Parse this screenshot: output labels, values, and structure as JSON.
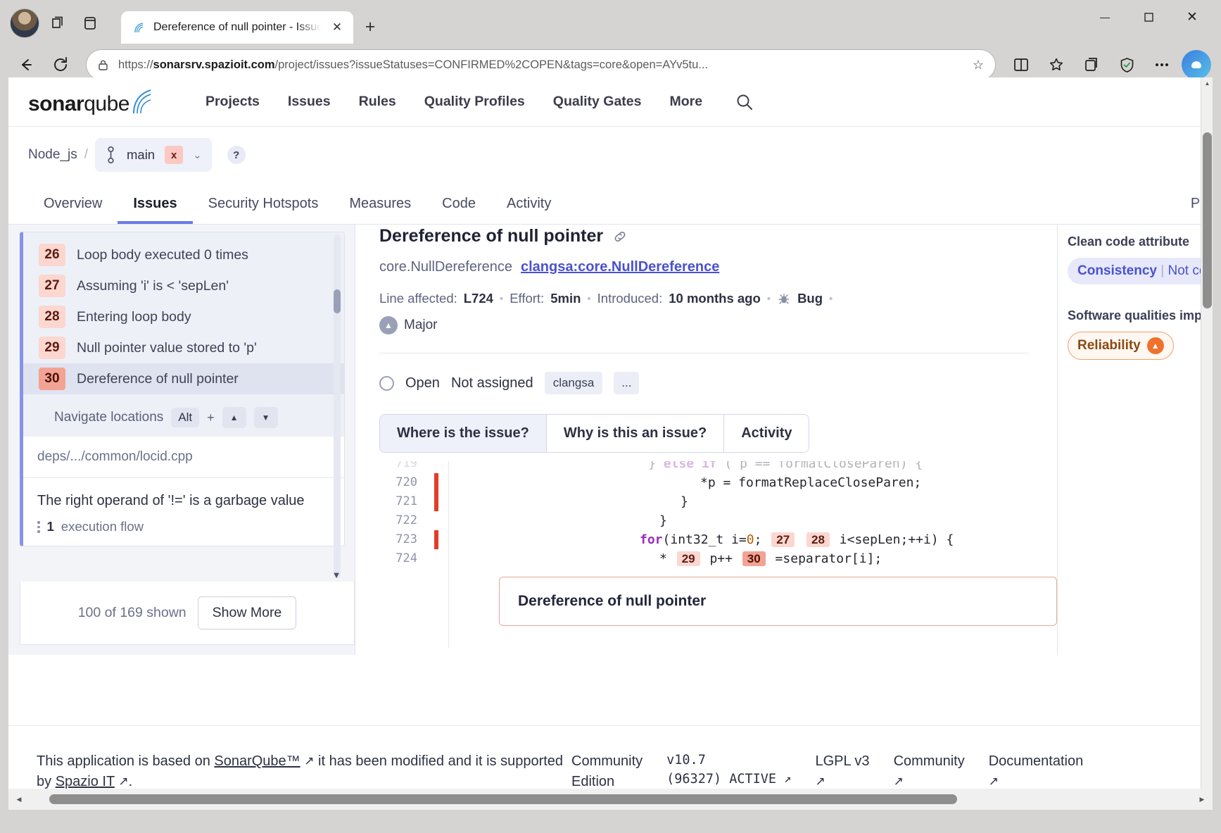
{
  "browser": {
    "tab": {
      "title": "Dereference of null pointer - Issue",
      "favicon_icon": "sonarqube-favicon"
    },
    "new_tab_label": "+",
    "url": {
      "scheme": "https://",
      "host": "sonarsrv.spazioit.com",
      "path": "/project/issues?issueStatuses=CONFIRMED%2COPEN&tags=core&open=AYv5tu...",
      "full": "https://sonarsrv.spazioit.com/project/issues?issueStatuses=CONFIRMED%2COPEN&tags=core&open=AYv5tu..."
    },
    "window_controls": {
      "minimize": "—",
      "maximize": "▢",
      "close": "✕"
    }
  },
  "sonarqube_nav": {
    "logo_prefix": "sonar",
    "logo_suffix": "qube",
    "items": [
      {
        "label": "Projects"
      },
      {
        "label": "Issues"
      },
      {
        "label": "Rules"
      },
      {
        "label": "Quality Profiles"
      },
      {
        "label": "Quality Gates"
      },
      {
        "label": "More"
      }
    ],
    "search_icon": "search-icon"
  },
  "breadcrumb": {
    "project": "Node_js",
    "separator": "/",
    "branch": "main",
    "branch_badge": "x",
    "help": "?"
  },
  "project_tabs": [
    {
      "label": "Overview",
      "active": false
    },
    {
      "label": "Security Hotspots",
      "active": false
    },
    {
      "label": "Measures",
      "active": false
    },
    {
      "label": "Code",
      "active": false
    },
    {
      "label": "Activity",
      "active": false
    }
  ],
  "project_tab_issues": "Issues",
  "project_tab_cut": "Pro",
  "issue_list": {
    "flow_steps": [
      {
        "num": "26",
        "text": "Loop body executed 0 times",
        "selected": false
      },
      {
        "num": "27",
        "text": "Assuming 'i' is < 'sepLen'",
        "selected": false
      },
      {
        "num": "28",
        "text": "Entering loop body",
        "selected": false
      },
      {
        "num": "29",
        "text": "Null pointer value stored to 'p'",
        "selected": false
      },
      {
        "num": "30",
        "text": "Dereference of null pointer",
        "selected": true
      }
    ],
    "navigate_label": "Navigate locations",
    "navigate_key": "Alt",
    "navigate_plus": "+",
    "navigate_up": "▲",
    "navigate_down": "▼",
    "file_path": "deps/.../common/locid.cpp",
    "message": "The right operand of '!=' is a garbage value",
    "flow_count": "1",
    "flow_label": "execution flow",
    "shown_count": "100 of 169 shown",
    "show_more": "Show More"
  },
  "issue_detail": {
    "title": "Dereference of null pointer",
    "permalink_icon": "link-icon",
    "rule_name": "core.NullDereference",
    "rule_key": "clangsa:core.NullDereference",
    "line_affected_label": "Line affected:",
    "line_affected": "L724",
    "effort_label": "Effort:",
    "effort": "5min",
    "introduced_label": "Introduced:",
    "introduced": "10 months ago",
    "type_icon": "bug-icon",
    "type": "Bug",
    "severity_icon": "severity-major-icon",
    "severity": "Major",
    "status": "Open",
    "assignee": "Not assigned",
    "tag": "clangsa",
    "tag_more": "...",
    "tabs": [
      {
        "label": "Where is the issue?",
        "active": true
      },
      {
        "label": "Why is this an issue?",
        "active": false
      },
      {
        "label": "Activity",
        "active": false
      }
    ],
    "banner_text": "Dereference of null pointer"
  },
  "code": {
    "lines": [
      {
        "num": "719",
        "marked": false,
        "cut": true,
        "text": "} else if ( p == formatCloseParen) {"
      },
      {
        "num": "720",
        "marked": true,
        "text": "*p = formatReplaceCloseParen;"
      },
      {
        "num": "721",
        "marked": false,
        "text": "}"
      },
      {
        "num": "722",
        "marked": false,
        "text": "}"
      },
      {
        "num": "723",
        "marked": true,
        "text": "for(int32_t i=0; [27] [28] i<sepLen;++i) {"
      },
      {
        "num": "724",
        "marked": false,
        "text": "* [29] p++ [30] =separator[i];"
      }
    ],
    "chips": {
      "c27": "27",
      "c28": "28",
      "c29": "29",
      "c30": "30"
    },
    "tokens": {
      "for_kw": "for",
      "else_kw": "else if",
      "zero": "0"
    }
  },
  "right_rail": {
    "clean_code_heading": "Clean code attribute",
    "attribute_primary": "Consistency",
    "attribute_sep": "|",
    "attribute_secondary": "Not conve",
    "qualities_heading": "Software qualities impact",
    "quality": "Reliability",
    "quality_icon": "severity-high-icon"
  },
  "footer": {
    "text_before": "This application is based on ",
    "link1": "SonarQube™",
    "text_mid": " it has been modified and it is supported by ",
    "link2": "Spazio IT",
    "text_after": ".",
    "edition_line1": "Community",
    "edition_line2": "Edition",
    "version_line1": "v10.7",
    "version_line2": "(96327) ACTIVE",
    "license": "LGPL v3",
    "community": "Community",
    "documentation": "Documentation",
    "external_icon": "external-link-icon"
  },
  "colors": {
    "accent_blue": "#4a51cf",
    "branch_active": "#6b7ae8",
    "chip_red": "#fbd7d0",
    "chip_red_hot": "#f3a394",
    "code_marker": "#e33d28",
    "reliability_orange": "#f0712c"
  }
}
